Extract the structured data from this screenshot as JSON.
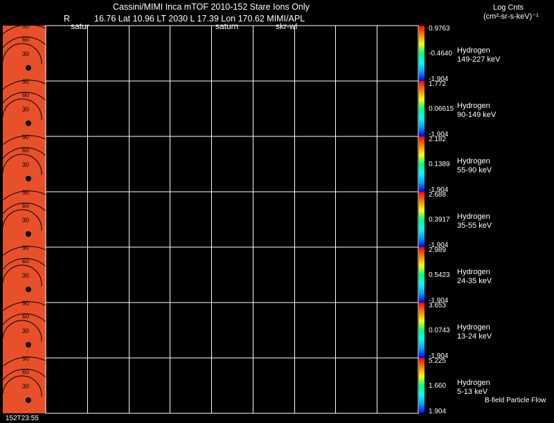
{
  "header": {
    "title": "Cassini/MIMI Inca mTOF  2010-152   Stare   Ions Only",
    "r_label": "R",
    "position_line": "16.76 Lat 10.96 LT 2030 L     17.39 Lon     170.62  MIMI/APL",
    "target_left": "satur",
    "target_mid": "saturn",
    "sky_label": "skr-wl"
  },
  "units": {
    "title": "Log Cnts",
    "label": "(cm²-sr-s-keV)⁻¹"
  },
  "footer": {
    "time": "152T23:55",
    "legend": "B-field Particle Flow"
  },
  "colors": {
    "background": "#000000",
    "grid": "#ffffff",
    "image_fill": "#e8502a"
  },
  "chart_data": {
    "type": "heatmap",
    "grid_columns": 9,
    "image_ring_labels": [
      "90",
      "60",
      "30",
      "0"
    ],
    "colorbar_colors": [
      "#0000ff",
      "#00a0ff",
      "#00ffff",
      "#00ff80",
      "#ffff00",
      "#ff8000",
      "#ff0000"
    ],
    "panels": [
      {
        "species": "Hydrogen",
        "energy": "149-227 keV",
        "max": "0.9763",
        "mid": "-0.4640",
        "min": "-1.904"
      },
      {
        "species": "Hydrogen",
        "energy": "90-149 keV",
        "max": "1.772",
        "mid": "0.06615",
        "min": "-1.904"
      },
      {
        "species": "Hydrogen",
        "energy": "55-90 keV",
        "max": "2.182",
        "mid": "0.1389",
        "min": "-1.904"
      },
      {
        "species": "Hydrogen",
        "energy": "35-55 keV",
        "max": "2.688",
        "mid": "0.3917",
        "min": "-1.904"
      },
      {
        "species": "Hydrogen",
        "energy": "24-35 keV",
        "max": "2.989",
        "mid": "0.5423",
        "min": "-1.904"
      },
      {
        "species": "Hydrogen",
        "energy": "13-24 keV",
        "max": "3.653",
        "mid": "0.0743",
        "min": "-1.904"
      },
      {
        "species": "Hydrogen",
        "energy": "5-13 keV",
        "max": "5.225",
        "mid": "1.660",
        "min": "1.904"
      }
    ]
  }
}
